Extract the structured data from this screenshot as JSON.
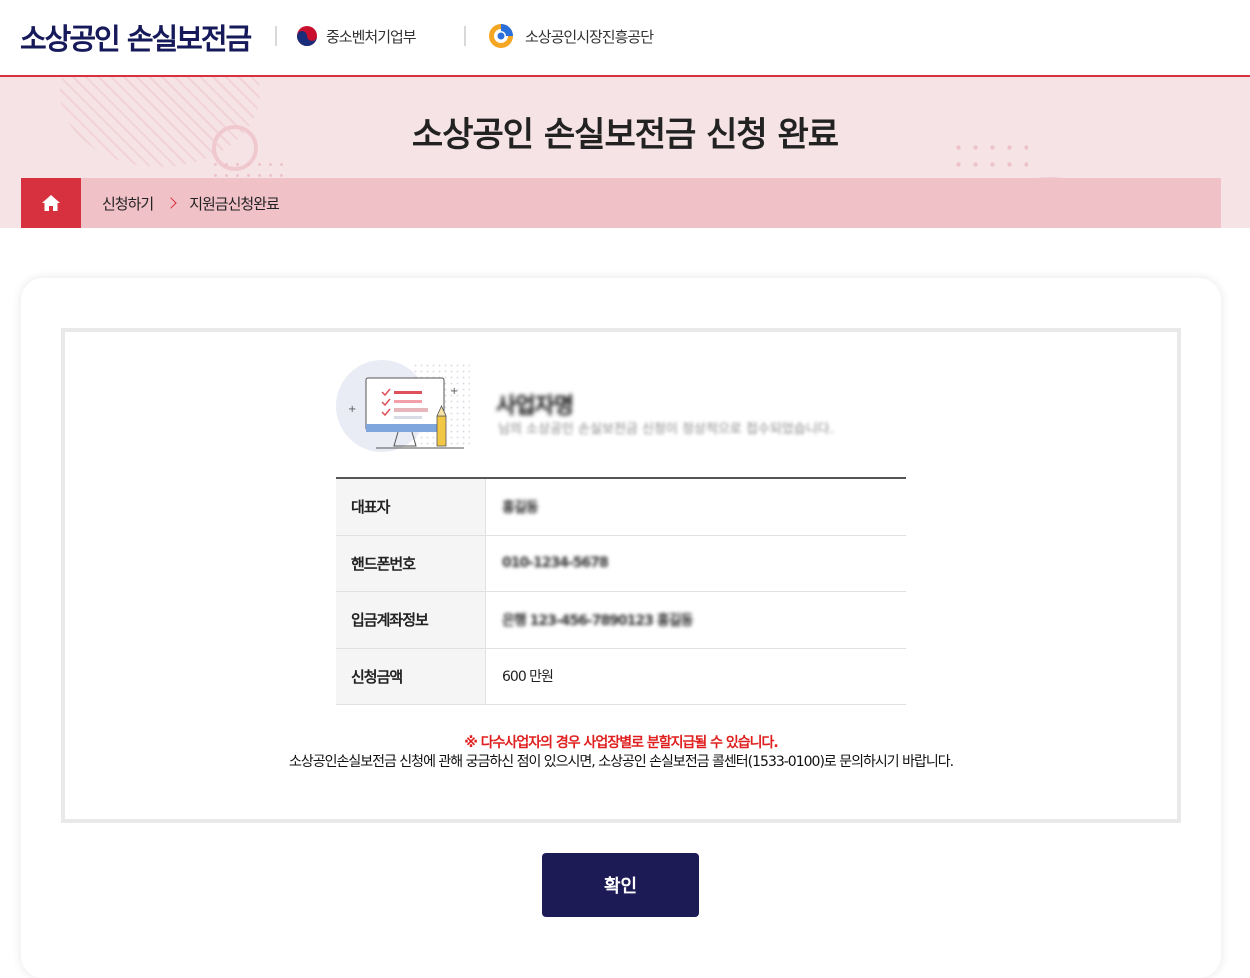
{
  "header": {
    "site_title": "소상공인 손실보전금",
    "ministry_logo_text": "중소벤처기업부",
    "agency_logo_text": "소상공인시장진흥공단"
  },
  "banner": {
    "title": "소상공인 손실보전금 신청 완료",
    "breadcrumb": [
      "신청하기",
      "지원금신청완료"
    ]
  },
  "completion": {
    "title_redacted": "사업자명",
    "subtitle_redacted": "님의 소상공인 손실보전금 신청이 정상적으로 접수되었습니다.",
    "rows": [
      {
        "label": "대표자",
        "value": "홍길동"
      },
      {
        "label": "핸드폰번호",
        "value": "010-1234-5678"
      },
      {
        "label": "입금계좌정보",
        "value": "은행 123-456-7890123 홍길동"
      },
      {
        "label": "신청금액",
        "value": "600 만원"
      }
    ],
    "notice_red": "※ 다수사업자의 경우 사업장별로 분할지급될 수 있습니다.",
    "notice_black": "소상공인손실보전금 신청에 관해 궁금하신 점이 있으시면, 소상공인 손실보전금 콜센터(1533-0100)로 문의하시기 바랍니다.",
    "confirm_label": "확인"
  },
  "colors": {
    "brand_navy": "#1c1b55",
    "accent_red": "#d7313f",
    "banner_pink": "#f6e3e6"
  }
}
